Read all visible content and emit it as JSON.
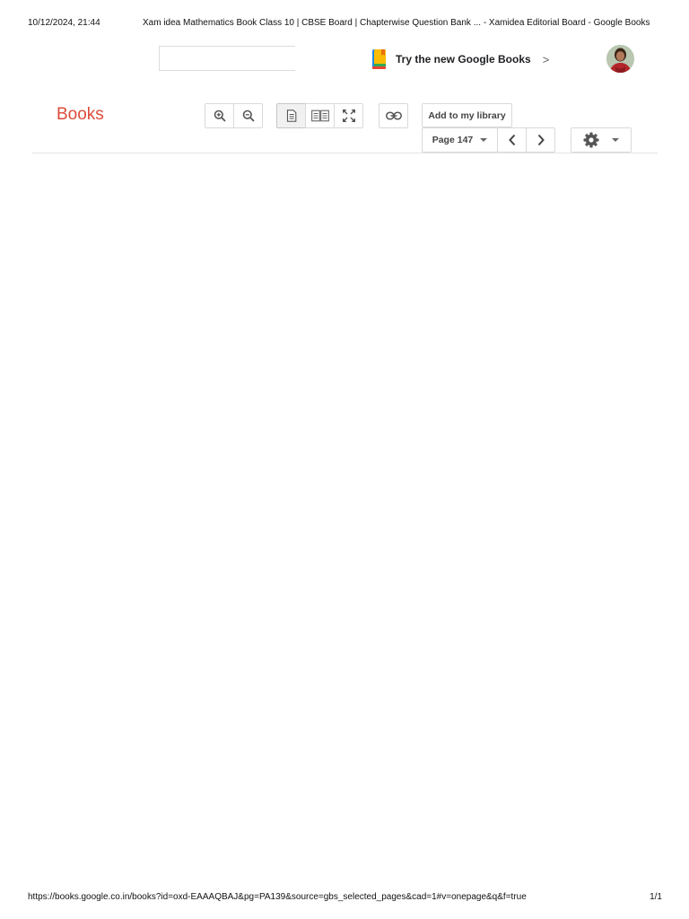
{
  "print_header": {
    "datetime": "10/12/2024, 21:44",
    "title": "Xam idea Mathematics Book Class 10 | CBSE Board | Chapterwise Question Bank ... - Xamidea Editorial Board - Google Books"
  },
  "top_bar": {
    "search_value": "",
    "try_new_label": "Try the new Google Books",
    "try_new_chevron": ">"
  },
  "toolbar": {
    "logo_text": "Books",
    "add_to_library_label": "Add to my library",
    "page_selector_label": "Page 147"
  },
  "print_footer": {
    "url": "https://books.google.co.in/books?id=oxd-EAAAQBAJ&pg=PA139&source=gbs_selected_pages&cad=1#v=onepage&q&f=true",
    "page_count": "1/1"
  },
  "icons": {
    "zoom_in": "zoom-in-icon",
    "zoom_out": "zoom-out-icon",
    "single_page": "single-page-icon",
    "two_page": "two-page-icon",
    "fullscreen": "fullscreen-icon",
    "link": "link-icon",
    "prev": "chevron-left-icon",
    "next": "chevron-right-icon",
    "settings": "gear-icon",
    "dropdown": "caret-down-icon",
    "google_books": "google-books-icon"
  },
  "colors": {
    "logo": "#dd4b39",
    "border": "#d9d9d9",
    "icon": "#555555"
  }
}
